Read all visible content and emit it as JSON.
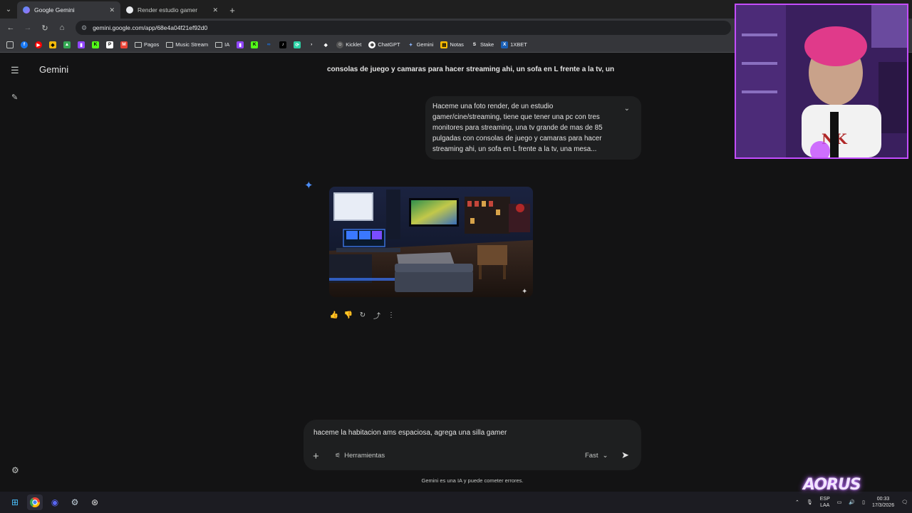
{
  "browser": {
    "tabs": [
      {
        "title": "Google Gemini",
        "active": true
      },
      {
        "title": "Render estudio gamer",
        "active": false
      }
    ],
    "url": "gemini.google.com/app/68e4a04f21ef92d0",
    "bookmarks": [
      "Pagos",
      "Music Stream",
      "IA",
      "Kicklet",
      "ChatGPT",
      "Gemini",
      "Notas",
      "Stake",
      "1XBET"
    ]
  },
  "app": {
    "brand": "Gemini",
    "top_user_text": "consolas de juego y camaras para hacer streaming ahi, un sofa en L frente a la tv, un",
    "user_message": "Haceme una foto render, de un estudio gamer/cine/streaming, tiene que tener una pc con tres monitores para streaming, una tv grande de mas de 85 pulgadas con consolas de juego y camaras para hacer streaming ahi, un sofa en L frente a la tv, una mesa...",
    "composer": {
      "value": "haceme la habitacion ams espaciosa, agrega una silla gamer",
      "tools_label": "Herramientas",
      "mode_label": "Fast"
    },
    "disclaimer": "Gemini es una IA y puede cometer errores."
  },
  "taskbar": {
    "lang_top": "ESP",
    "lang_bottom": "LAA",
    "time": "00:33",
    "date": "17/3/2026",
    "watermark": "AORUS"
  },
  "colors": {
    "accent": "#4c8df6",
    "webcam_border": "#c44dff",
    "background": "#131314"
  }
}
